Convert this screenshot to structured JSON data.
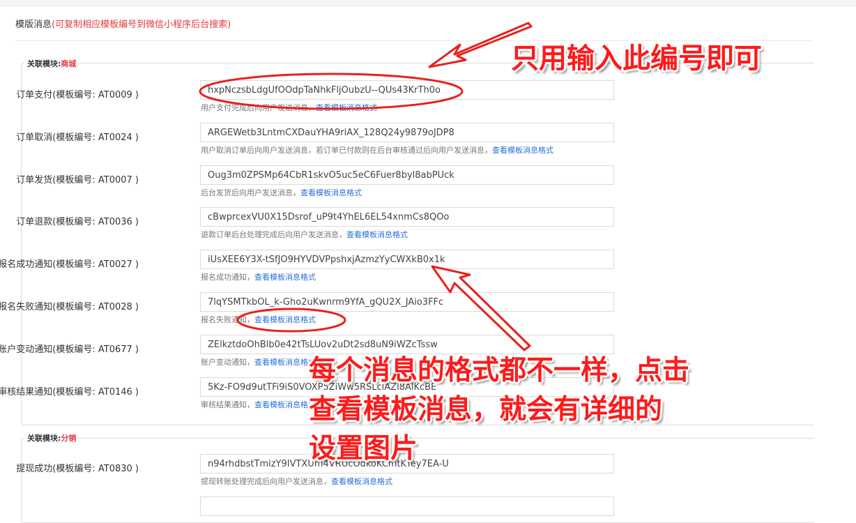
{
  "header": {
    "title": "模版消息",
    "hint": "(可复制相应模板编号到微信小程序后台搜索)"
  },
  "legend_prefix": "关联模块:",
  "modules": [
    {
      "name": "商城",
      "rows": [
        {
          "label": "订单支付(模板编号: AT0009 )",
          "value": "hxpNczsbLdgUfOOdpTaNhkFljOubzU--QUs43KrTh0o",
          "help": "用户支付完成后向用户发送消息，",
          "link": "查看模板消息格式"
        },
        {
          "label": "订单取消(模板编号: AT0024 )",
          "value": "ARGEWetb3LntmCXDauYHA9riAX_128Q24y9879oJDP8",
          "help": "用户取消订单后向用户发送消息，若订单已付款则在后台审核通过后向用户发送消息，",
          "link": "查看模板消息格式"
        },
        {
          "label": "订单发货(模板编号: AT0007 )",
          "value": "Oug3m0ZPSMp64CbR1skvO5uc5eC6Fuer8byl8abPUck",
          "help": "后台发货后向用户发送消息，",
          "link": "查看模板消息格式"
        },
        {
          "label": "订单退款(模板编号: AT0036 )",
          "value": "cBwprcexVU0X15Dsrof_uP9t4YhEL6EL54xnmCs8QOo",
          "help": "退款订单后台处理完成后向用户发送消息，",
          "link": "查看模板消息格式"
        },
        {
          "label": "报名成功通知(模板编号: AT0027 )",
          "value": "iUsXEE6Y3X-tSfJO9HYVDVPpshxjAzmzYyCWXkB0x1k",
          "help": "报名成功通知，",
          "link": "查看模板消息格式"
        },
        {
          "label": "报名失败通知(模板编号: AT0028 )",
          "value": "7lqYSMTkbOL_k-Gho2uKwnrm9YfA_gQU2X_JAio3FFc",
          "help": "报名失败通知，",
          "link": "查看模板消息格式"
        },
        {
          "label": "账户变动通知(模板编号: AT0677 )",
          "value": "ZElkztdoOhBlb0e42tTsLUov2uDt2sd8uN9iWZcTssw",
          "help": "账户变动通知，",
          "link": "查看模板消息格式"
        },
        {
          "label": "审核结果通知(模板编号: AT0146 )",
          "value": "5Kz-FO9d9utTFi9iS0VOXP5ZiWw5RSLclAZl8AlKcBE",
          "help": "审核结果通知，",
          "link": "查看模板消息格式"
        }
      ]
    },
    {
      "name": "分销",
      "rows": [
        {
          "label": "提现成功(模板编号: AT0830 )",
          "value": "n94rhdbstTmizY9IVTXUm4VRUcOdkoKCmtKYey7EA-U",
          "help": "提现转账处理完成后向用户发送消息，",
          "link": "查看模板消息格式"
        }
      ]
    }
  ],
  "annotations": {
    "top_callout": "只用输入此编号即可",
    "bottom_callout_line1": "每个消息的格式都不一样，点击",
    "bottom_callout_line2": "查看模板消息，就会有详细的",
    "bottom_callout_line3": "设置图片",
    "color": "#ff1a1a"
  }
}
